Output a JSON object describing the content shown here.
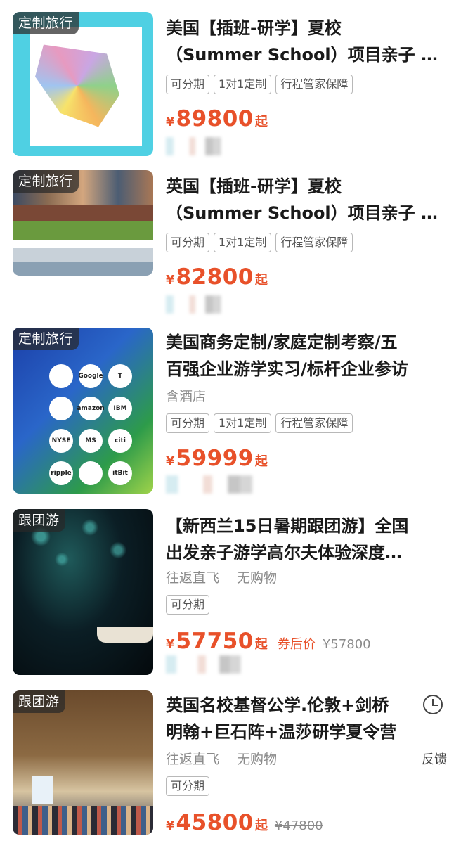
{
  "items": [
    {
      "tag": "定制旅行",
      "title": "美国【插班-研学】夏校\n（Summer School）项目亲子 …",
      "chips": [
        "可分期",
        "1对1定制",
        "行程管家保障"
      ],
      "price": "89800",
      "yen": "¥",
      "suffix": "起"
    },
    {
      "tag": "定制旅行",
      "title": "英国【插班-研学】夏校\n（Summer School）项目亲子 …",
      "chips": [
        "可分期",
        "1对1定制",
        "行程管家保障"
      ],
      "price": "82800",
      "yen": "¥",
      "suffix": "起"
    },
    {
      "tag": "定制旅行",
      "title": "美国商务定制/家庭定制考察/五\n百强企业游学实习/标杆企业参访",
      "subtitle": "含酒店",
      "chips": [
        "可分期",
        "1对1定制",
        "行程管家保障"
      ],
      "price": "59999",
      "yen": "¥",
      "suffix": "起",
      "logos": [
        "",
        "Google",
        "T",
        "",
        "amazon",
        "IBM",
        "NYSE",
        "MS",
        "citi",
        "ripple",
        "",
        "itBit"
      ]
    },
    {
      "tag": "跟团游",
      "title": "【新西兰15日暑期跟团游】全国\n出发亲子游学高尔夫体验深度…",
      "sub_a": "往返直飞",
      "sub_b": "无购物",
      "chips": [
        "可分期"
      ],
      "price": "57750",
      "yen": "¥",
      "suffix": "起",
      "coupon": "券后价",
      "orig": "¥57800"
    },
    {
      "tag": "跟团游",
      "title": "英国名校基督公学.伦敦+剑桥\n明翰+巨石阵+温莎研学夏令营",
      "sub_a": "往返直飞",
      "sub_b": "无购物",
      "chips": [
        "可分期"
      ],
      "price": "45800",
      "yen": "¥",
      "suffix": "起",
      "orig": "¥47800",
      "feedback": "反馈"
    }
  ],
  "colors": {
    "price": "#e8512a",
    "tag_bg": "rgba(40,40,40,0.72)"
  }
}
